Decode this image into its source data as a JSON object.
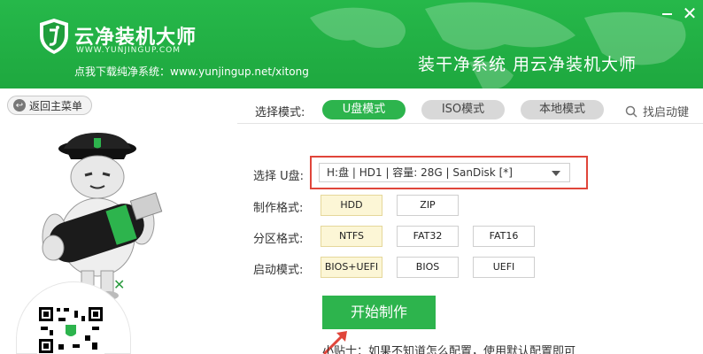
{
  "header": {
    "title": "云净装机大师",
    "domain": "WWW.YUNJINGUP.COM",
    "subtitle": "点我下载纯净系统：www.yunjingup.net/xitong",
    "slogan": "装干净系统  用云净装机大师"
  },
  "window": {
    "minimize_icon": "minimize-icon",
    "close_icon": "close-icon",
    "close_glyph": "✕"
  },
  "back_button": {
    "label": "返回主菜单",
    "icon": "back-arrow-icon"
  },
  "mode_bar": {
    "label": "选择模式:",
    "modes": [
      {
        "label": "U盘模式",
        "active": true
      },
      {
        "label": "ISO模式",
        "active": false
      },
      {
        "label": "本地模式",
        "active": false
      }
    ],
    "help_label": "找启动键"
  },
  "form": {
    "drive_label": "选择 U盘:",
    "drive_value": "H:盘 | HD1 | 容量: 28G | SanDisk [*]",
    "format_label": "制作格式:",
    "format_options": [
      {
        "label": "HDD",
        "selected": true
      },
      {
        "label": "ZIP",
        "selected": false
      }
    ],
    "partition_label": "分区格式:",
    "partition_options": [
      {
        "label": "NTFS",
        "selected": true
      },
      {
        "label": "FAT32",
        "selected": false
      },
      {
        "label": "FAT16",
        "selected": false
      }
    ],
    "boot_label": "启动模式:",
    "boot_options": [
      {
        "label": "BIOS+UEFI",
        "selected": true
      },
      {
        "label": "BIOS",
        "selected": false
      },
      {
        "label": "UEFI",
        "selected": false
      }
    ]
  },
  "start_button": {
    "label": "开始制作"
  },
  "tip": "小贴士：如果不知道怎么配置，使用默认配置即可",
  "colors": {
    "brand_green": "#26b84a",
    "accent_red": "#e0453a",
    "selected_bg": "#fcf6d6"
  }
}
